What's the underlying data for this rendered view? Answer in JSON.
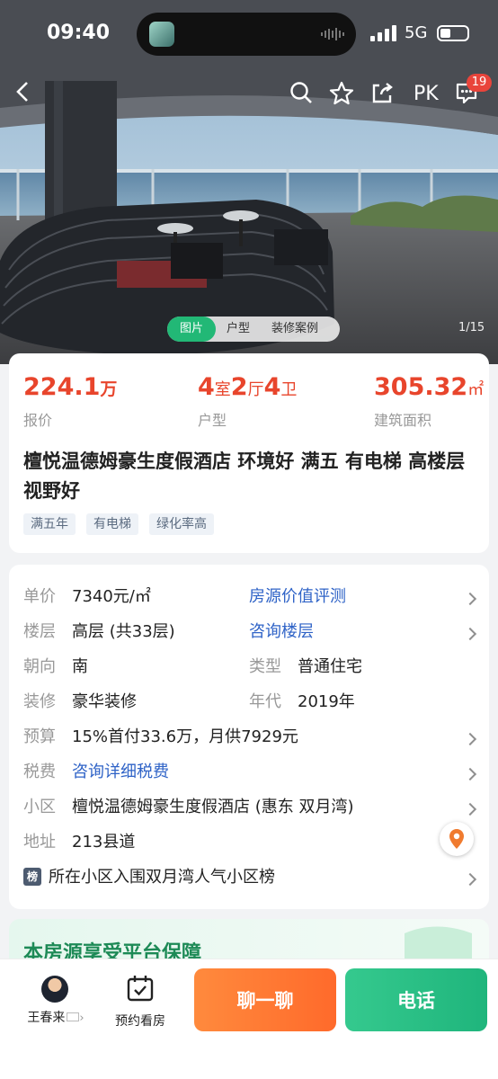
{
  "status_bar": {
    "time": "09:40",
    "network": "5G"
  },
  "top_nav": {
    "pk_label": "PK",
    "message_badge": "19"
  },
  "photo": {
    "tabs": [
      "图片",
      "户型",
      "装修案例"
    ],
    "active_tab": "图片",
    "counter": "1/15"
  },
  "summary": {
    "price": {
      "value": "224.1",
      "unit": "万",
      "label": "报价"
    },
    "layout": {
      "n1": "4",
      "u1": "室",
      "n2": "2",
      "u2": "厅",
      "n3": "4",
      "u3": "卫",
      "label": "户型"
    },
    "area": {
      "value": "305.32",
      "unit": "㎡",
      "label": "建筑面积"
    },
    "title": "檀悦温德姆豪生度假酒店 环境好 满五 有电梯 高楼层视野好",
    "tags": [
      "满五年",
      "有电梯",
      "绿化率高"
    ]
  },
  "details": {
    "unit_price": {
      "key": "单价",
      "value": "7340元/㎡",
      "link": "房源价值评测"
    },
    "floor": {
      "key": "楼层",
      "value": "高层 (共33层)",
      "link": "咨询楼层"
    },
    "orientation": {
      "key": "朝向",
      "value": "南"
    },
    "type": {
      "key": "类型",
      "value": "普通住宅"
    },
    "decoration": {
      "key": "装修",
      "value": "豪华装修"
    },
    "year": {
      "key": "年代",
      "value": "2019年"
    },
    "budget": {
      "key": "预算",
      "value": "15%首付33.6万，月供7929元"
    },
    "tax": {
      "key": "税费",
      "link": "咨询详细税费"
    },
    "community": {
      "key": "小区",
      "value": "檀悦温德姆豪生度假酒店 (惠东 双月湾)"
    },
    "address": {
      "key": "地址",
      "value": "213县道"
    },
    "ranking": {
      "icon_text": "榜",
      "text": "所在小区入围双月湾人气小区榜"
    }
  },
  "guarantee": {
    "title": "本房源享受平台保障"
  },
  "bottom_bar": {
    "agent_name": "王春来",
    "book_label": "预约看房",
    "chat_label": "聊一聊",
    "call_label": "电话"
  },
  "colors": {
    "price_red": "#e8452c",
    "link_blue": "#2f63c7",
    "brand_green": "#22b876",
    "chat_orange": "#ff7a33",
    "call_green": "#2bbf85"
  }
}
